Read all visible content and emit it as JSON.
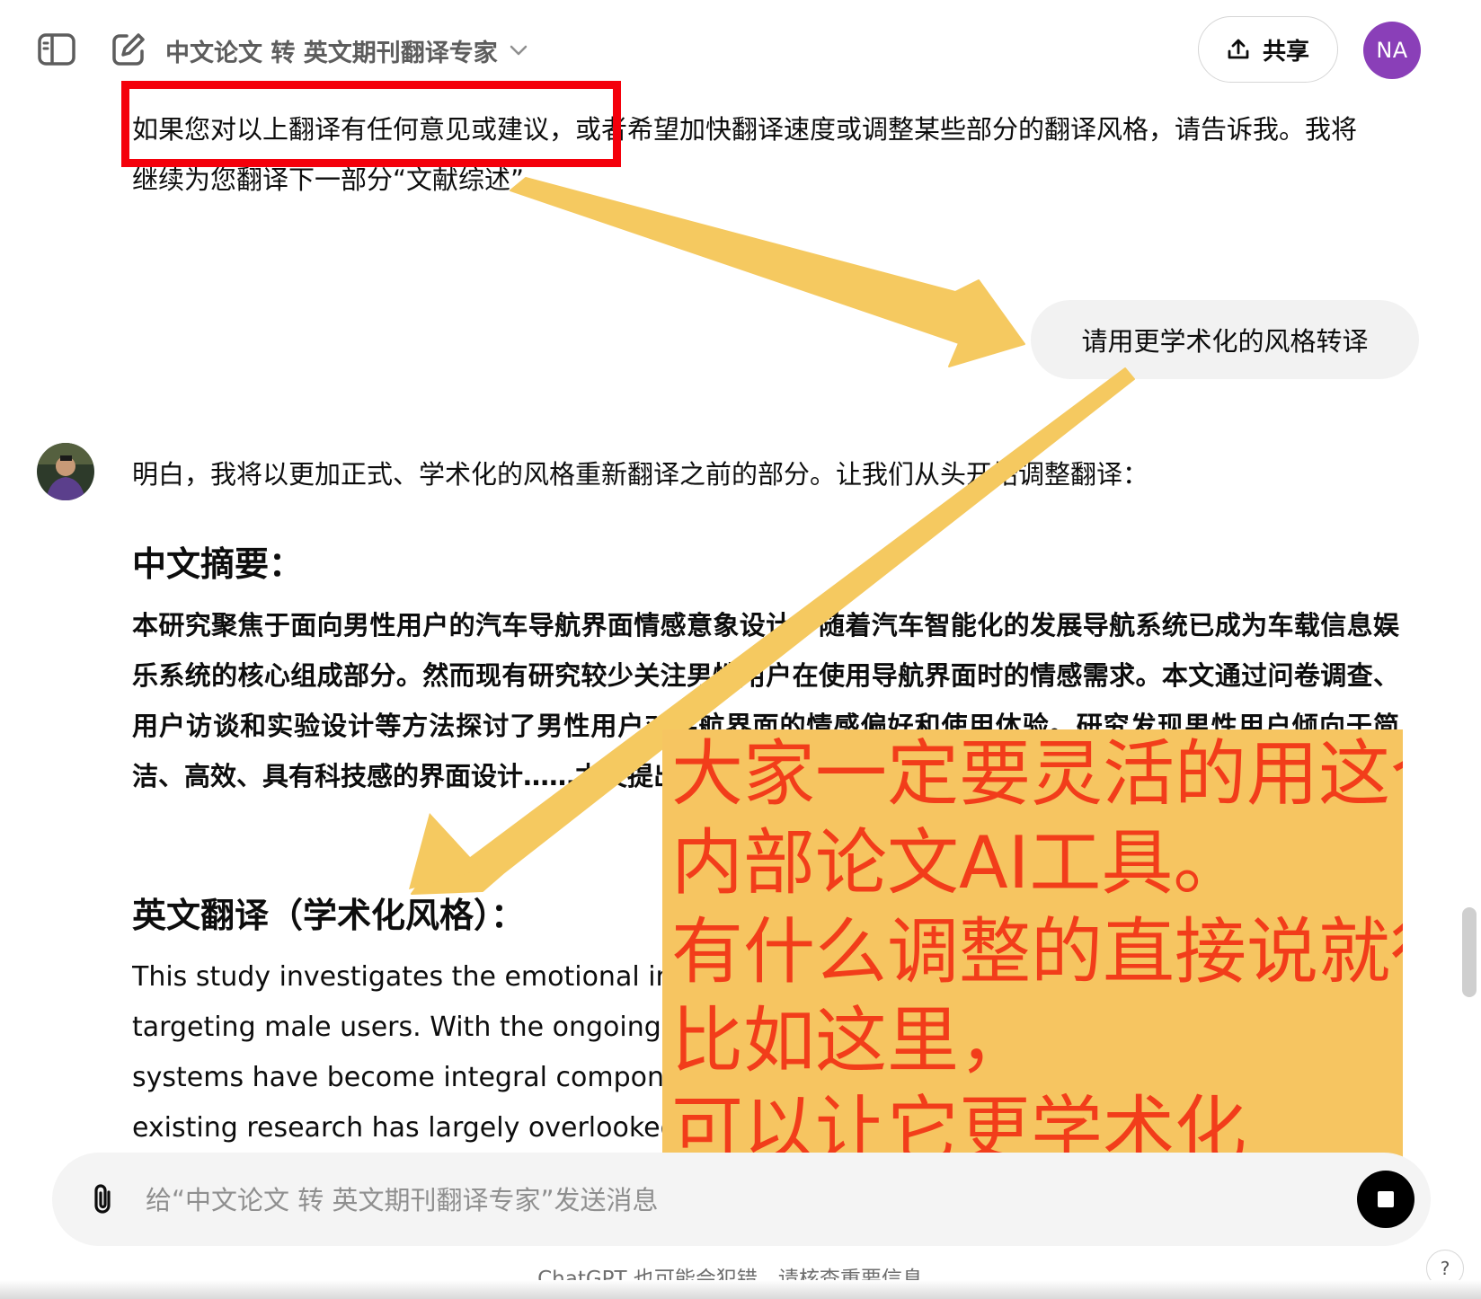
{
  "header": {
    "model_title": "中文论文 转 英文期刊翻译专家",
    "share_label": "共享",
    "user_initials": "NA"
  },
  "conversation": {
    "prev_paragraph": "如果您对以上翻译有任何意见或建议，或者希望加快翻译速度或调整某些部分的翻译风格，请告诉我。我将继续为您翻译下一部分“文献综述”。",
    "user_message": "请用更学术化的风格转译",
    "assistant": {
      "intro": "明白，我将以更加正式、学术化的风格重新翻译之前的部分。让我们从头开始调整翻译：",
      "heading_cn": "中文摘要：",
      "paragraph_cn": "本研究聚焦于面向男性用户的汽车导航界面情感意象设计。随着汽车智能化的发展导航系统已成为车载信息娱乐系统的核心组成部分。然而现有研究较少关注男性用户在使用导航界面时的情感需求。本文通过问卷调查、用户访谈和实验设计等方法探讨了男性用户对导航界面的情感偏好和使用体验。研究发现男性用户倾向于简洁、高效、具有科技感的界面设计……本文提出的面向男性用户的导航界面情感意象设计策略旨在提升……",
      "heading_en": "英文翻译（学术化风格）：",
      "paragraph_en": "This study investigates the emotional imagery design of automotive navigation interfaces targeting male users. With the ongoing development of automotive intelligence, navigation systems have become integral components of in-vehicle infotainment systems. However, existing research has largely overlooked the emotional needs of male users."
    }
  },
  "annotation": {
    "note": "大家一定要灵活的用这个\n内部论文AI工具。\n有什么调整的直接说就行。\n比如这里，\n可以让它更学术化",
    "highlight_color": "#f4000b",
    "arrow_color": "#f5c960",
    "note_bg": "#f6c561",
    "note_text_color": "#f23d1a"
  },
  "composer": {
    "placeholder": "给“中文论文 转 英文期刊翻译专家”发送消息",
    "value": ""
  },
  "footer": {
    "disclaimer": "ChatGPT 也可能会犯错。请核查重要信息。",
    "help_label": "?"
  },
  "icons": {
    "sidebar": "sidebar-toggle-icon",
    "new_chat": "edit-icon",
    "dropdown": "chevron-down-icon",
    "share": "upload-icon",
    "attach": "paperclip-icon",
    "stop": "stop-icon"
  }
}
